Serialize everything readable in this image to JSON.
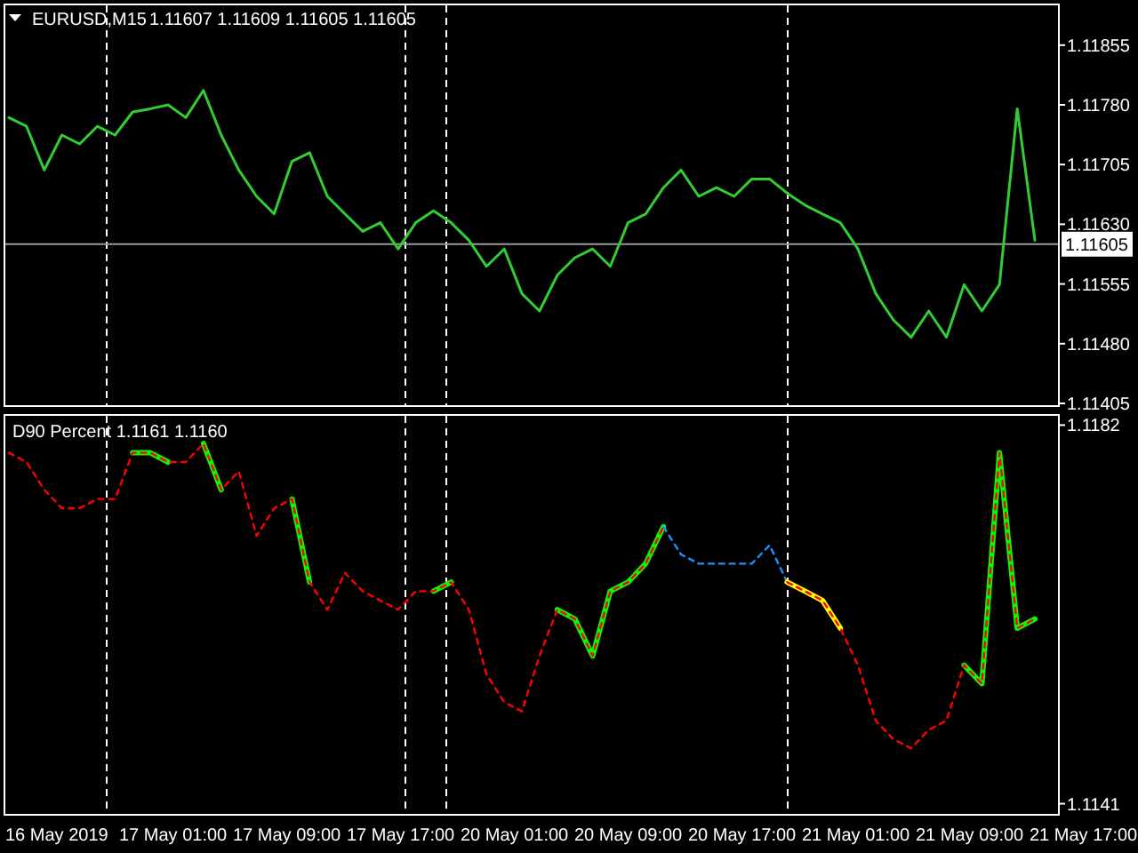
{
  "price_pane": {
    "symbol": "EURUSD,M15",
    "quote": "1.11607 1.11609 1.11605 1.11605",
    "chart_data": {
      "type": "line",
      "ylim": [
        1.11405,
        1.11905
      ],
      "yticks": [
        {
          "value": 1.11855,
          "label": "1.11855"
        },
        {
          "value": 1.1178,
          "label": "1.11780"
        },
        {
          "value": 1.11705,
          "label": "1.11705"
        },
        {
          "value": 1.1163,
          "label": "1.11630"
        },
        {
          "value": 1.11555,
          "label": "1.11555"
        },
        {
          "value": 1.1148,
          "label": "1.11480"
        },
        {
          "value": 1.11405,
          "label": "1.11405"
        }
      ],
      "ref_lines": [
        {
          "axis": "y",
          "value": 1.11605,
          "label": "1.11605",
          "color": "#999999"
        }
      ],
      "series": [
        {
          "color": "#32cd32",
          "line_style": "solid",
          "values": [
            1.11764,
            1.11753,
            1.11698,
            1.11742,
            1.11731,
            1.11753,
            1.11742,
            1.11771,
            1.11775,
            1.1178,
            1.11764,
            1.11798,
            1.11742,
            1.11698,
            1.11665,
            1.11643,
            1.11709,
            1.1172,
            1.11665,
            1.11643,
            1.11621,
            1.11632,
            1.11599,
            1.11632,
            1.11647,
            1.11632,
            1.1161,
            1.11577,
            1.11599,
            1.11543,
            1.11521,
            1.11566,
            1.11588,
            1.11599,
            1.11577,
            1.11632,
            1.11643,
            1.11676,
            1.11698,
            1.11665,
            1.11676,
            1.11665,
            1.11687,
            1.11687,
            1.11669,
            1.11654,
            1.11643,
            1.11632,
            1.11599,
            1.11543,
            1.1151,
            1.11488,
            1.11521,
            1.11488,
            1.11554,
            1.11521,
            1.11554,
            1.11775,
            1.1161
          ]
        }
      ]
    }
  },
  "indicator_pane": {
    "title": "D90 Percent 1.1161 1.1160",
    "chart_data": {
      "type": "line",
      "ylim": [
        1.11398,
        1.11831
      ],
      "yticks": [
        {
          "value": 1.1182,
          "label": "1.1182"
        },
        {
          "value": 1.1141,
          "label": "1.1141"
        }
      ],
      "series": [
        {
          "color": "#00ff00",
          "line_style": "solid",
          "values": [
            null,
            null,
            null,
            null,
            null,
            null,
            null,
            1.1179,
            1.1179,
            1.1178,
            null,
            1.118,
            1.1175,
            null,
            null,
            null,
            1.1174,
            1.1165,
            null,
            null,
            null,
            null,
            null,
            null,
            1.1164,
            1.1165,
            null,
            null,
            null,
            null,
            null,
            1.1162,
            1.1161,
            1.1157,
            1.1164,
            1.1165,
            1.1167,
            1.1171,
            null,
            null,
            null,
            null,
            null,
            null,
            null,
            null,
            null,
            null,
            null,
            null,
            null,
            null,
            null,
            null,
            1.1156,
            1.1154,
            1.1179,
            1.116,
            1.1161
          ]
        },
        {
          "color": "#1e90ff",
          "line_style": "dashed",
          "values": [
            null,
            null,
            null,
            null,
            null,
            null,
            null,
            null,
            null,
            null,
            null,
            null,
            null,
            null,
            null,
            null,
            null,
            null,
            null,
            null,
            null,
            null,
            null,
            null,
            null,
            null,
            null,
            null,
            null,
            null,
            null,
            null,
            null,
            null,
            null,
            null,
            null,
            1.1171,
            1.1168,
            1.1167,
            1.1167,
            1.1167,
            1.1167,
            1.1169,
            1.1165,
            null,
            null,
            null,
            null,
            null,
            null,
            null,
            null,
            null,
            null,
            null,
            null,
            null,
            null
          ]
        },
        {
          "color": "#ffff00",
          "line_style": "solid",
          "values": [
            null,
            null,
            null,
            null,
            null,
            null,
            null,
            null,
            null,
            null,
            null,
            null,
            null,
            null,
            null,
            null,
            null,
            null,
            null,
            null,
            null,
            null,
            null,
            null,
            null,
            null,
            null,
            null,
            null,
            null,
            null,
            null,
            null,
            null,
            null,
            null,
            null,
            null,
            null,
            null,
            null,
            null,
            null,
            null,
            1.1165,
            1.1164,
            1.1163,
            1.116,
            null,
            null,
            null,
            null,
            null,
            null,
            null,
            null,
            null,
            null,
            null
          ]
        },
        {
          "color": "#ff0000",
          "line_style": "dashed",
          "values": [
            1.1179,
            1.1178,
            1.1175,
            1.1173,
            1.1173,
            1.1174,
            1.1174,
            1.1179,
            1.1179,
            1.1178,
            1.1178,
            1.118,
            1.1175,
            1.1177,
            1.117,
            1.1173,
            1.1174,
            1.1165,
            1.1162,
            1.1166,
            1.1164,
            1.1163,
            1.1162,
            1.1164,
            1.1164,
            1.1165,
            1.1162,
            1.1155,
            1.1152,
            1.1151,
            1.1157,
            1.1162,
            1.1161,
            1.1157,
            1.1164,
            1.1165,
            1.1167,
            1.1171,
            null,
            null,
            null,
            null,
            null,
            null,
            1.1165,
            1.1164,
            1.1163,
            1.116,
            1.1156,
            1.115,
            1.1148,
            1.1147,
            1.1149,
            1.115,
            1.1156,
            1.1154,
            1.1179,
            1.116,
            1.1161
          ]
        }
      ]
    }
  },
  "time_axis": [
    "16 May 2019",
    "17 May 01:00",
    "17 May 09:00",
    "17 May 17:00",
    "20 May 01:00",
    "20 May 09:00",
    "20 May 17:00",
    "21 May 01:00",
    "21 May 09:00",
    "21 May 17:00"
  ]
}
